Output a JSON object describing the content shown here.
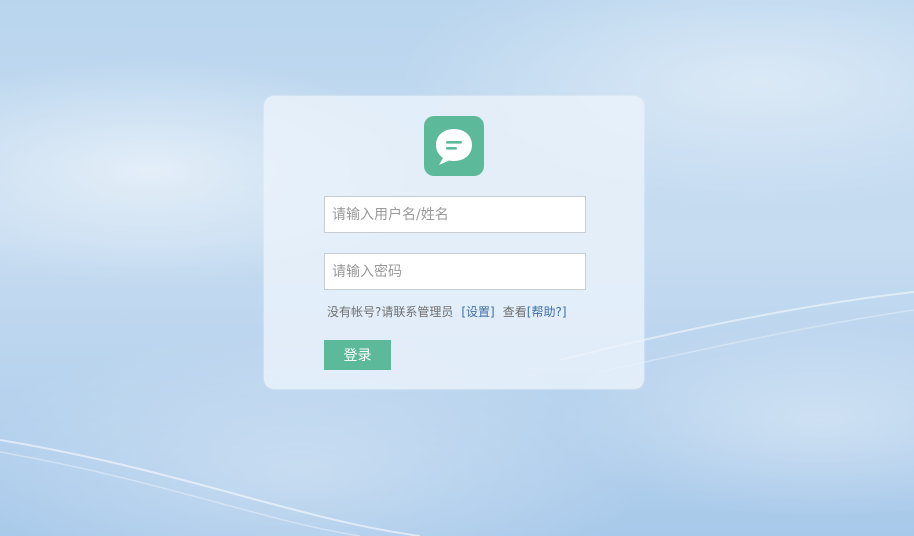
{
  "login": {
    "username_placeholder": "请输入用户名/姓名",
    "password_placeholder": "请输入密码",
    "no_account_text": "没有帐号?请联系管理员",
    "settings_link": "[设置]",
    "view_text": "查看",
    "help_link": "[帮助?]",
    "login_button": "登录"
  },
  "icons": {
    "logo": "chat-bubble-icon"
  },
  "colors": {
    "accent": "#5cba9b",
    "link": "#3f6fa8",
    "card_background": "#ecf3fb"
  }
}
